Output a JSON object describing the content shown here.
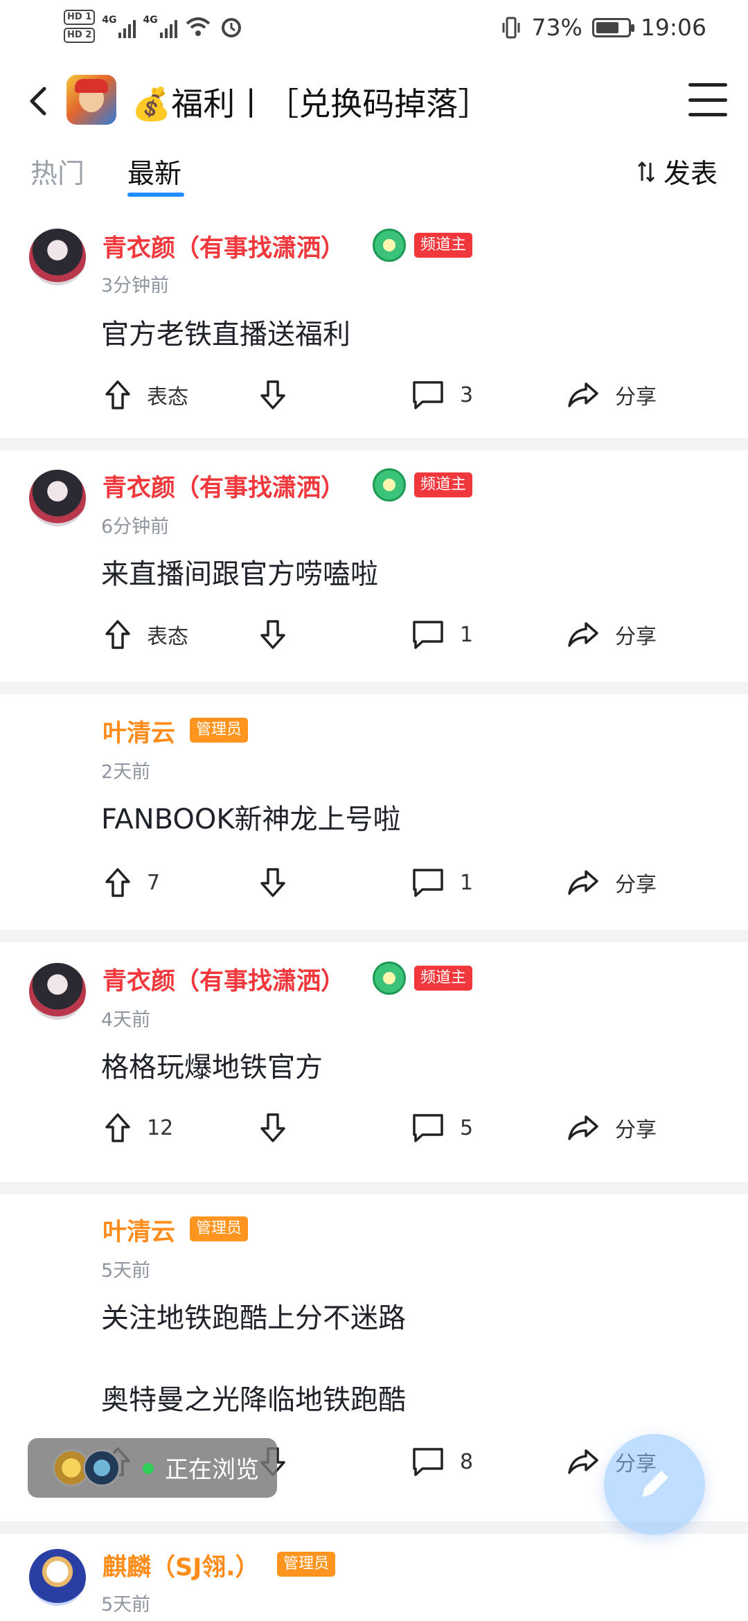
{
  "status": {
    "hd1": "HD 1",
    "hd2": "HD 2",
    "net1": "4G",
    "net2": "4G",
    "battery_percent": "73%",
    "battery_level": 0.73,
    "time": "19:06"
  },
  "header": {
    "title": "💰福利丨［兑换码掉落］",
    "game_icon": "subway-surfers-icon"
  },
  "tabs": {
    "hot": "热门",
    "new": "最新",
    "active": "最新",
    "post": "发表"
  },
  "posts": [
    {
      "author": "青衣颜（有事找潇洒）",
      "role": "频道主",
      "time": "3分钟前",
      "text": "官方老铁直播送福利",
      "text2": "",
      "likes": "表态",
      "comments": "3",
      "share": "分享"
    },
    {
      "author": "青衣颜（有事找潇洒）",
      "role": "频道主",
      "time": "6分钟前",
      "text": "来直播间跟官方唠嗑啦",
      "text2": "",
      "likes": "表态",
      "comments": "1",
      "share": "分享"
    },
    {
      "author": "叶清云",
      "role": "管理员",
      "time": "2天前",
      "text": "FANBOOK新神龙上号啦",
      "text2": "",
      "likes": "7",
      "comments": "1",
      "share": "分享"
    },
    {
      "author": "青衣颜（有事找潇洒）",
      "role": "频道主",
      "time": "4天前",
      "text": "格格玩爆地铁官方",
      "text2": "",
      "likes": "12",
      "comments": "5",
      "share": "分享"
    },
    {
      "author": "叶清云",
      "role": "管理员",
      "time": "5天前",
      "text": "关注地铁跑酷上分不迷路",
      "text2": "奥特曼之光降临地铁跑酷",
      "likes": "",
      "comments": "8",
      "share": "分享"
    },
    {
      "author": "麒麟（SJ翎.）",
      "role": "管理员",
      "time": "5天前"
    }
  ],
  "floating": {
    "label": "正在浏览"
  },
  "colors": {
    "owner_name": "#f0373b",
    "admin_name": "#ff8c1a",
    "accent": "#1f8bff"
  }
}
